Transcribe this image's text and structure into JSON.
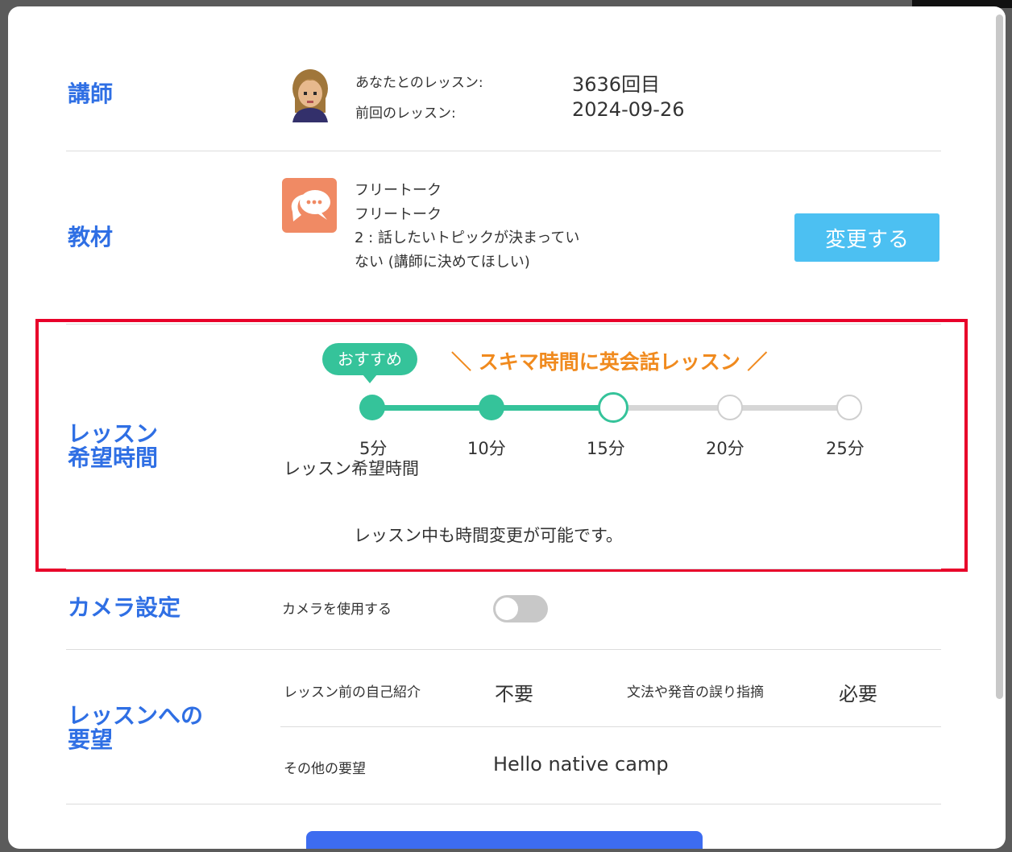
{
  "teacher": {
    "title": "講師",
    "lesson_count_label": "あなたとのレッスン:",
    "lesson_count_value": "3636回目",
    "last_lesson_label": "前回のレッスン:",
    "last_lesson_value": "2024-09-26"
  },
  "material": {
    "title": "教材",
    "icon": "speech-bubbles-icon",
    "line1": "フリートーク",
    "line2": "フリートーク",
    "line3": "2 : 話したいトピックが決まっていない (講師に決めてほしい)",
    "change_button": "変更する"
  },
  "duration": {
    "title": "レッスン\n希望時間",
    "recommend_badge": "おすすめ",
    "catchphrase": "＼ スキマ時間に英会話レッスン ／",
    "options": [
      "5分",
      "10分",
      "15分",
      "20分",
      "25分"
    ],
    "selected_value": "15分",
    "slider_caption": "レッスン希望時間",
    "note": "レッスン中も時間変更が可能です。",
    "accent_color": "#35c39a"
  },
  "camera": {
    "title": "カメラ設定",
    "label": "カメラを使用する",
    "enabled": false
  },
  "requests": {
    "title": "レッスンへの\n要望",
    "self_intro_label": "レッスン前の自己紹介",
    "self_intro_value": "不要",
    "correction_label": "文法や発音の誤り指摘",
    "correction_value": "必要",
    "other_label": "その他の要望",
    "other_value": "Hello native camp"
  },
  "colors": {
    "section_title": "#2f6fe4",
    "highlight_border": "#e8002a",
    "catchphrase": "#f08a1e",
    "change_button": "#4cc0f2",
    "primary_button": "#3d6cf0"
  }
}
